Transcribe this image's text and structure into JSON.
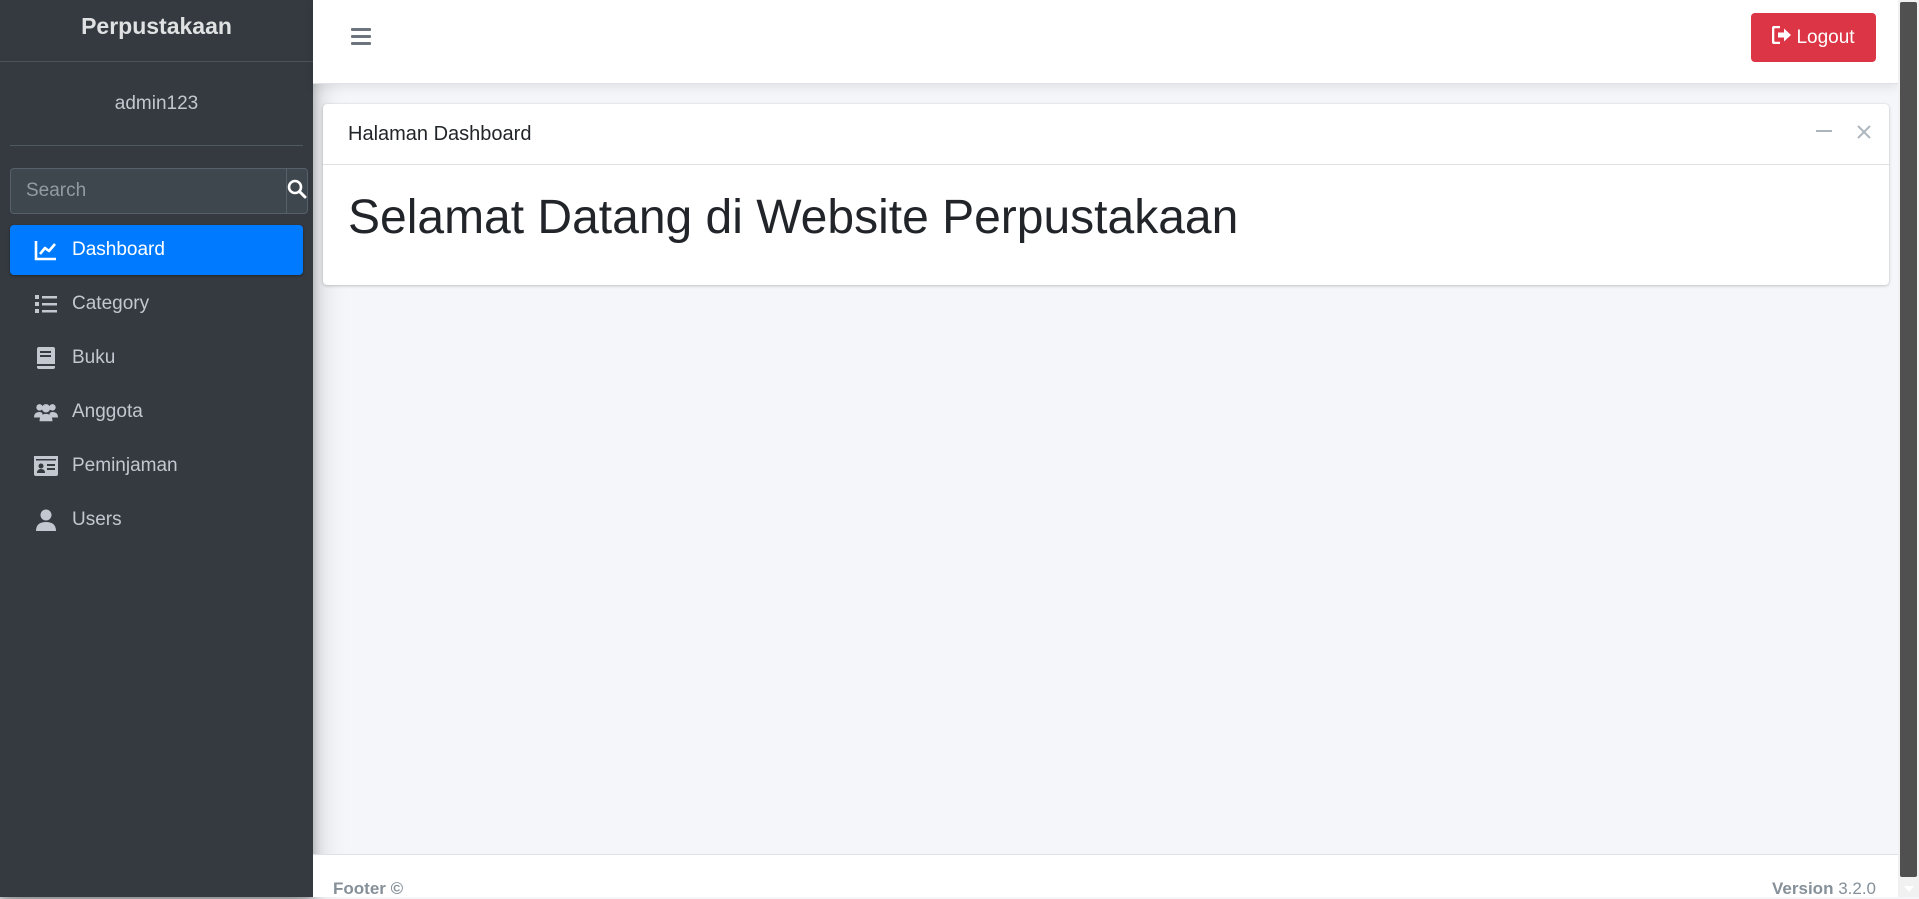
{
  "brand": {
    "title": "Perpustakaan"
  },
  "user": {
    "name": "admin123"
  },
  "search": {
    "placeholder": "Search"
  },
  "nav": {
    "items": [
      {
        "label": "Dashboard",
        "icon": "chart-line-icon",
        "active": true
      },
      {
        "label": "Category",
        "icon": "list-icon",
        "active": false
      },
      {
        "label": "Buku",
        "icon": "book-icon",
        "active": false
      },
      {
        "label": "Anggota",
        "icon": "users-icon",
        "active": false
      },
      {
        "label": "Peminjaman",
        "icon": "id-card-icon",
        "active": false
      },
      {
        "label": "Users",
        "icon": "user-icon",
        "active": false
      }
    ]
  },
  "topbar": {
    "logout_label": "Logout"
  },
  "card": {
    "header_title": "Halaman Dashboard",
    "welcome_text": "Selamat Datang di Website Perpustakaan"
  },
  "footer": {
    "left_text": "Footer ©",
    "version_label": "Version",
    "version_value": "3.2.0"
  },
  "colors": {
    "sidebar_bg": "#343a40",
    "active_nav": "#007bff",
    "logout_bg": "#dc3545",
    "content_bg": "#f4f6f9"
  }
}
